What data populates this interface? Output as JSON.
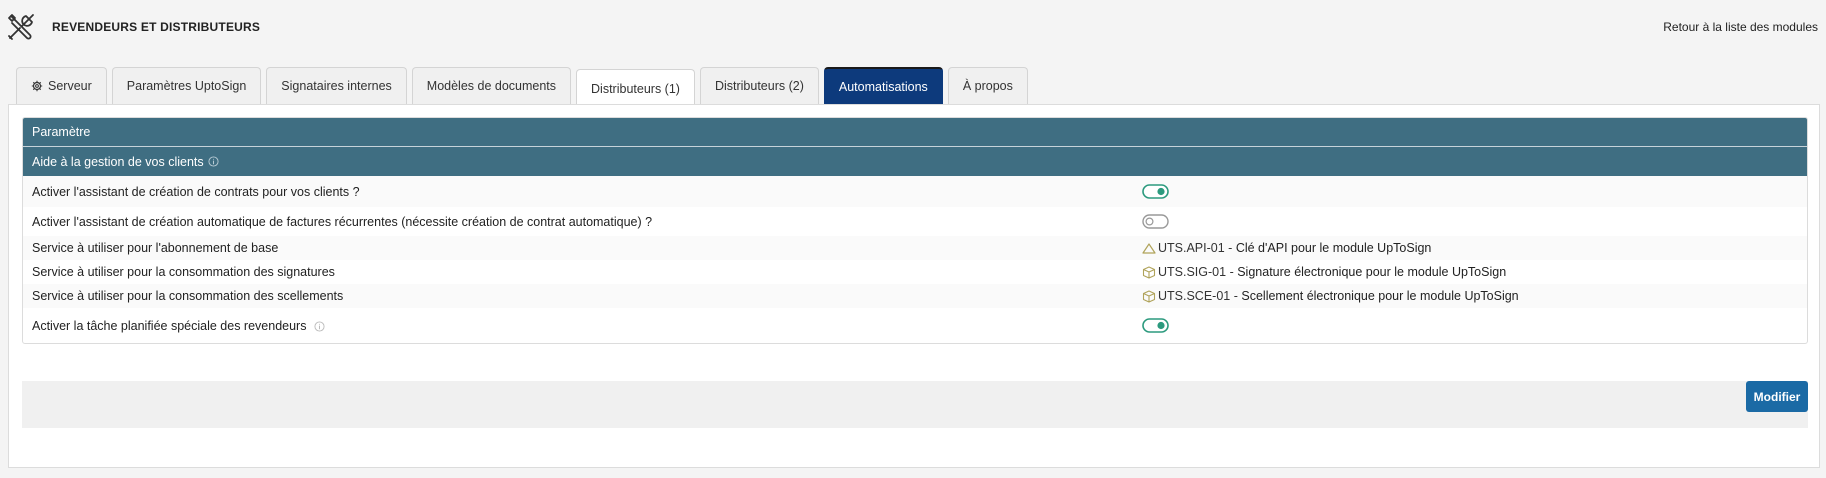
{
  "header": {
    "title": "REVENDEURS ET DISTRIBUTEURS",
    "back_link": "Retour à la liste des modules",
    "icon": "tools-icon"
  },
  "tabs": [
    {
      "label": "Serveur",
      "icon": "gear-icon",
      "active": false
    },
    {
      "label": "Paramètres UptoSign",
      "active": false
    },
    {
      "label": "Signataires internes",
      "active": false
    },
    {
      "label": "Modèles de documents",
      "active": false
    },
    {
      "label": "Distributeurs (1)",
      "active": false
    },
    {
      "label": "Distributeurs (2)",
      "active": false
    },
    {
      "label": "Automatisations",
      "active": true
    },
    {
      "label": "À propos",
      "active": false
    }
  ],
  "table": {
    "header": "Paramètre",
    "section": "Aide à la gestion de vos clients",
    "rows": [
      {
        "label": "Activer l'assistant de création de contrats pour vos clients ?",
        "toggle": true
      },
      {
        "label": "Activer l'assistant de création automatique de factures récurrentes (nécessite création de contrat automatique) ?",
        "toggle": false
      },
      {
        "label": "Service à utiliser pour l'abonnement de base",
        "icon": "service-icon",
        "code": "UTS.API-01",
        "desc": "Clé d'API pour le module UpToSign"
      },
      {
        "label": "Service à utiliser pour la consommation des signatures",
        "icon": "product-box-icon",
        "code": "UTS.SIG-01",
        "desc": "Signature électronique pour le module UpToSign"
      },
      {
        "label": "Service à utiliser pour la consommation des scellements",
        "icon": "product-box-icon",
        "code": "UTS.SCE-01",
        "desc": "Scellement électronique pour le module UpToSign"
      },
      {
        "label": "Activer la tâche planifiée spéciale des revendeurs",
        "toggle": true,
        "info": true
      }
    ]
  },
  "footer": {
    "modify_label": "Modifier"
  },
  "colors": {
    "accent": "#0d3a7c",
    "table_header": "#3f6e82",
    "toggle_on": "#2c9a7e",
    "button": "#1b6aa5"
  },
  "separator": "-"
}
